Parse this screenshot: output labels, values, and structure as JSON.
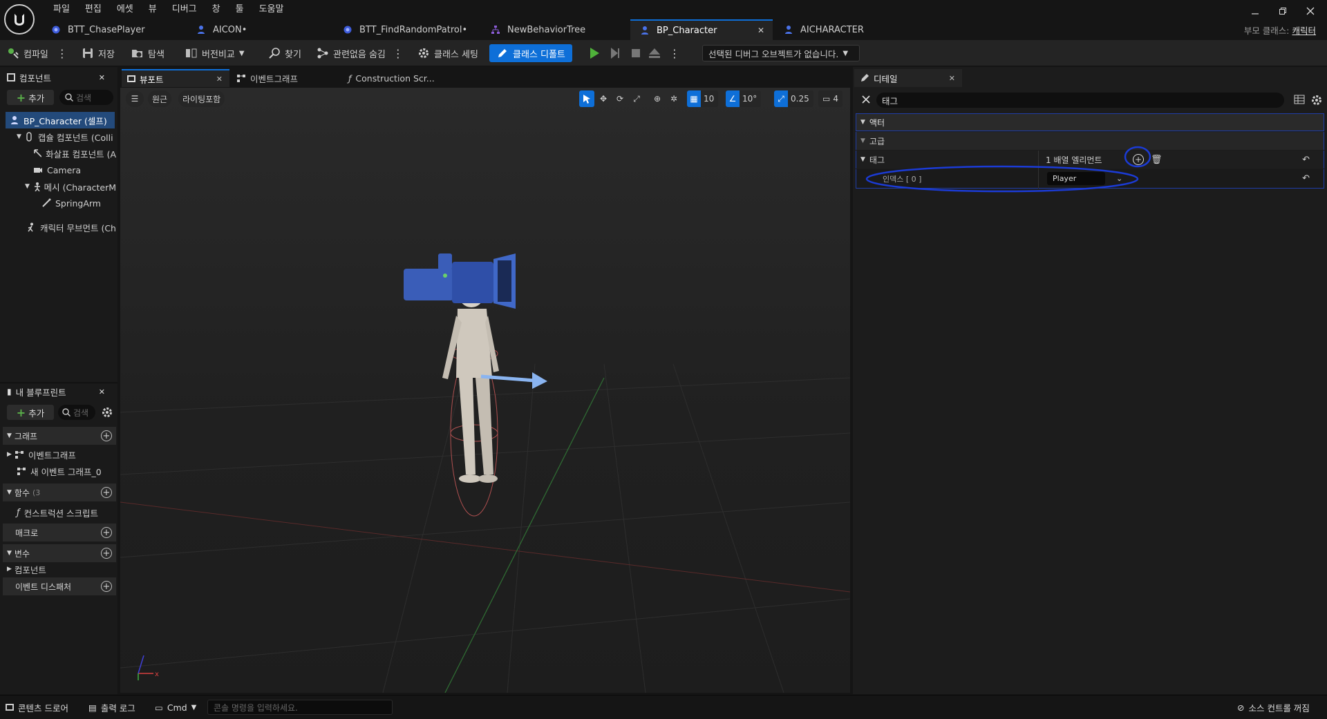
{
  "menu": [
    "파일",
    "편집",
    "에셋",
    "뷰",
    "디버그",
    "창",
    "툴",
    "도움말"
  ],
  "docTabs": [
    {
      "label": "BTT_ChasePlayer",
      "icon": "task-icon"
    },
    {
      "label": "AICON•",
      "icon": "pawn-icon"
    },
    {
      "label": "BTT_FindRandomPatrol•",
      "icon": "task-icon"
    },
    {
      "label": "NewBehaviorTree",
      "icon": "tree-icon"
    },
    {
      "label": "BP_Character",
      "icon": "pawn-icon",
      "active": true
    },
    {
      "label": "AICHARACTER",
      "icon": "pawn-icon"
    }
  ],
  "parentClass": {
    "label": "부모 클래스:",
    "value": "캐릭터"
  },
  "toolbar": {
    "compile": "컴파일",
    "save": "저장",
    "browse": "탐색",
    "diff": "버전비교",
    "find": "찾기",
    "hide": "관련없음 숨김",
    "classSettings": "클래스 세팅",
    "classDefaults": "클래스 디폴트",
    "debugSelect": "선택된 디버그 오브젝트가 없습니다."
  },
  "components": {
    "title": "컴포넌트",
    "add": "추가",
    "searchPlaceholder": "검색",
    "items": [
      {
        "label": "BP_Character (셀프)",
        "indent": 0,
        "selected": true
      },
      {
        "label": "캡슐 컴포넌트 (Colli",
        "indent": 1
      },
      {
        "label": "화살표 컴포넌트 (A",
        "indent": 2
      },
      {
        "label": "Camera",
        "indent": 2
      },
      {
        "label": "메시 (CharacterM",
        "indent": 2
      },
      {
        "label": "SpringArm",
        "indent": 3
      },
      {
        "label": "캐릭터 무브먼트 (Ch",
        "indent": 1
      }
    ]
  },
  "myBlueprint": {
    "title": "내 블루프린트",
    "add": "추가",
    "searchPlaceholder": "검색",
    "sections": {
      "graphs": "그래프",
      "eventGraph": "이벤트그래프",
      "newEventGraph": "새 이벤트 그래프_0",
      "functions": "함수",
      "functionsCount": "(3",
      "constructionScript": "컨스트럭션 스크립트",
      "macros": "매크로",
      "variables": "변수",
      "componentsCat": "컴포넌트",
      "dispatchers": "이벤트 디스패처"
    }
  },
  "editorTabs": {
    "viewport": "뷰포트",
    "eventGraph": "이벤트그래프",
    "construction": "Construction Scr..."
  },
  "viewport": {
    "perspective": "원근",
    "lighting": "라이팅포함",
    "gridSize": "10",
    "rotSnap": "10°",
    "scaleSnap": "0.25",
    "camSpeed": "4"
  },
  "details": {
    "title": "디테일",
    "search": "태그",
    "categories": {
      "actor": "액터",
      "advanced": "고급"
    },
    "tags": {
      "label": "태그",
      "count": "1 배열 엘리먼트",
      "indexLabel": "인덱스 [ 0 ]",
      "value": "Player"
    }
  },
  "bottom": {
    "contentDrawer": "콘텐츠 드로어",
    "outputLog": "출력 로그",
    "cmd": "Cmd",
    "consolePlaceholder": "콘솔 명령을 입력하세요.",
    "sourceControl": "소스 컨트롤 꺼짐"
  },
  "colors": {
    "accent": "#0e6fd8",
    "highlight": "#1b3bd6",
    "panel": "#1a1a1a"
  }
}
